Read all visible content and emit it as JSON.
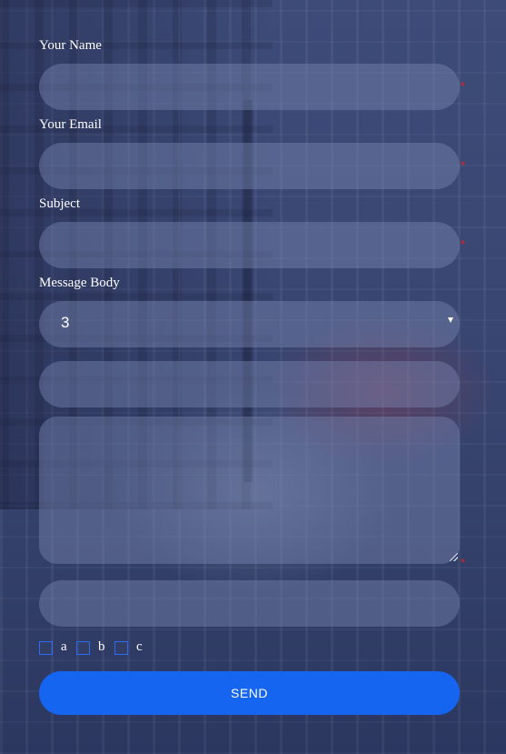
{
  "form": {
    "name_label": "Your Name",
    "email_label": "Your Email",
    "subject_label": "Subject",
    "message_label": "Message Body",
    "required_marker": "*",
    "select_value": "3",
    "send_label": "SEND",
    "checkboxes": [
      {
        "label": "a",
        "checked": false
      },
      {
        "label": "b",
        "checked": false
      },
      {
        "label": "c",
        "checked": false
      }
    ]
  },
  "colors": {
    "accent": "#1565f0",
    "required": "#e02222",
    "background": "#3a4773"
  }
}
